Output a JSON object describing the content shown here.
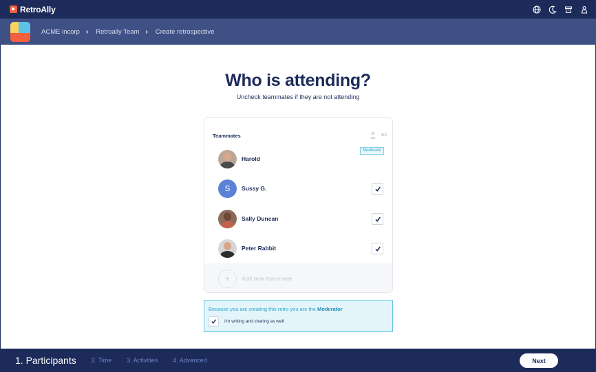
{
  "app": {
    "name": "RetroAlly"
  },
  "topbar": {
    "icons": [
      "globe-icon",
      "moon-icon",
      "archive-icon",
      "user-icon"
    ]
  },
  "breadcrumb": [
    "ACME incorp",
    "Retroally Team",
    "Create retrospective"
  ],
  "page": {
    "title": "Who is attending?",
    "subtitle": "Uncheck teammates if they are not attending"
  },
  "teammates": {
    "header": "Teammates",
    "count": "4/4",
    "moderator_badge": "Moderator",
    "members": [
      {
        "name": "Harold",
        "avatar": "photo",
        "moderator": true,
        "checked": null
      },
      {
        "name": "Sussy G.",
        "avatar": "S",
        "moderator": false,
        "checked": true
      },
      {
        "name": "Sally Duncan",
        "avatar": "photo",
        "moderator": false,
        "checked": true
      },
      {
        "name": "Peter Rabbit",
        "avatar": "photo",
        "moderator": false,
        "checked": true
      }
    ],
    "add_placeholder": "Add new teammate",
    "add_symbol": "+"
  },
  "notice": {
    "text_prefix": "Because you are creating this retro you are the ",
    "text_role": "Moderator",
    "option_label": "I'm writing and sharing as well",
    "option_checked": true
  },
  "steps": [
    "1. Participants",
    "2. Time",
    "3. Activities",
    "4. Advanced"
  ],
  "next_label": "Next",
  "colors": {
    "navy": "#1c2b5a",
    "crumb_bar": "#3f5085",
    "accent": "#2aa5cc",
    "logo": "#f2603f"
  }
}
